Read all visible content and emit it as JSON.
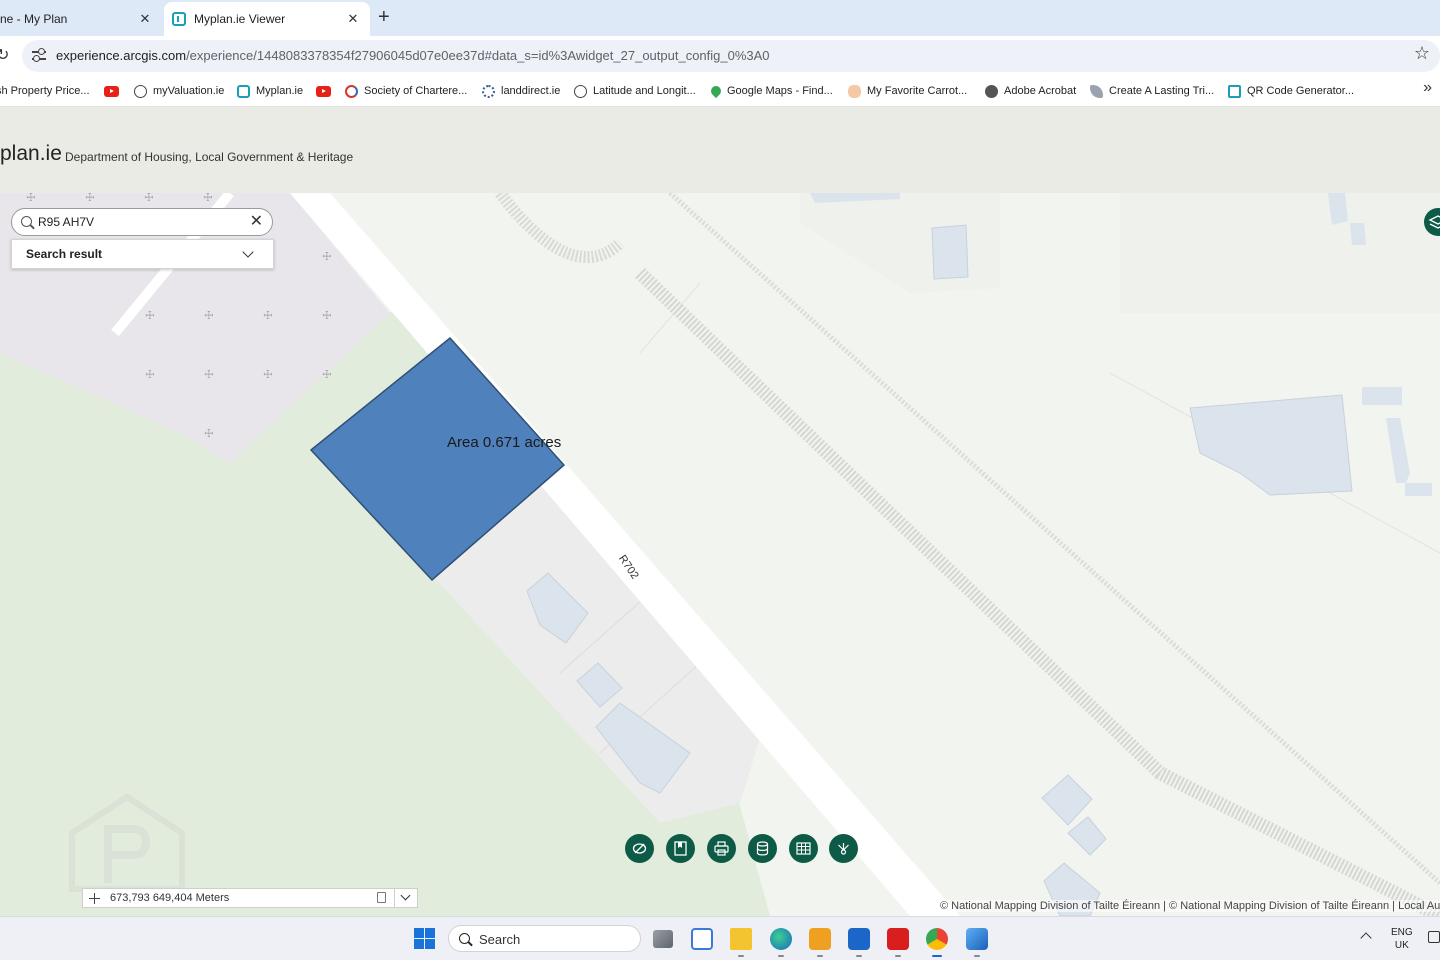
{
  "browser": {
    "tabs": [
      {
        "title": "ne - My Plan",
        "active": false
      },
      {
        "title": "Myplan.ie Viewer",
        "active": true
      }
    ],
    "url_host": "experience.arcgis.com",
    "url_rest": "/experience/1448083378354f27906045d07e0ee37d#data_s=id%3Awidget_27_output_config_0%3A0",
    "bookmarks": [
      {
        "label": "sh Property Price...",
        "icon": "globe-icon"
      },
      {
        "label": "",
        "icon": "youtube-icon"
      },
      {
        "label": "myValuation.ie",
        "icon": "globe-icon"
      },
      {
        "label": "Myplan.ie",
        "icon": "myplan-icon"
      },
      {
        "label": "",
        "icon": "youtube-icon"
      },
      {
        "label": "Society of Chartere...",
        "icon": "scsi-icon"
      },
      {
        "label": "landdirect.ie",
        "icon": "landdirect-icon"
      },
      {
        "label": "Latitude and Longit...",
        "icon": "compass-icon"
      },
      {
        "label": "Google Maps - Find...",
        "icon": "map-pin-icon"
      },
      {
        "label": "My Favorite Carrot...",
        "icon": "carrot-icon"
      },
      {
        "label": "Adobe Acrobat",
        "icon": "globe-icon"
      },
      {
        "label": "Create A Lasting Tri...",
        "icon": "bird-icon"
      },
      {
        "label": "QR Code Generator...",
        "icon": "qr-icon"
      }
    ]
  },
  "app": {
    "title": "plan.ie",
    "subtitle": "Department of Housing, Local Government & Heritage"
  },
  "map": {
    "search_value": "R95 AH7V",
    "results_label": "Search result",
    "area_label": "Area 0.671 acres",
    "road_label": "R702",
    "parcel_color": "#4f81bd",
    "tools": [
      "draw-icon",
      "bookmark-icon",
      "print-icon",
      "data-icon",
      "table-icon",
      "share-icon"
    ],
    "coordinates": "673,793 649,404 Meters",
    "attribution": "© National Mapping Division of Tailte Éireann | © National Mapping Division of Tailte Éireann | Local Aut"
  },
  "taskbar": {
    "search_label": "Search",
    "lang_line1": "ENG",
    "lang_line2": "UK"
  }
}
